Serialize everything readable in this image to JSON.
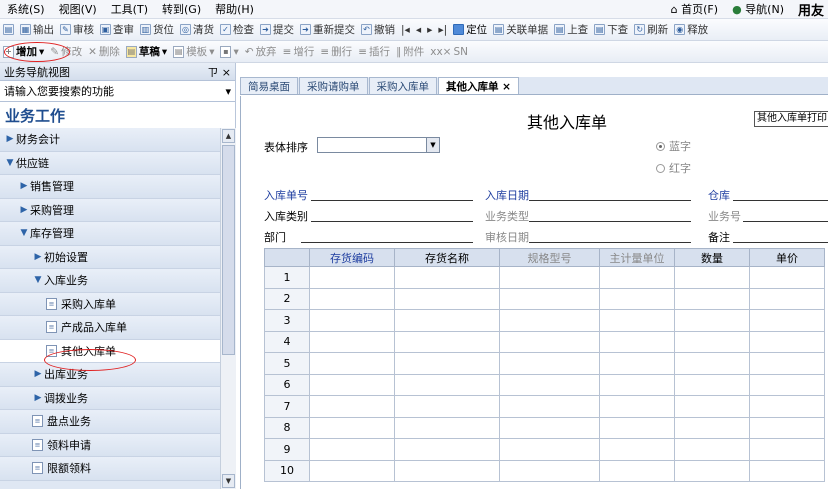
{
  "menubar": {
    "items": [
      "系统(S)",
      "视图(V)",
      "工具(T)",
      "转到(G)",
      "帮助(H)"
    ],
    "right": {
      "home": "首页(F)",
      "nav": "导航(N)",
      "brand": "用友"
    }
  },
  "toolbar1": {
    "items": [
      "输出",
      "审核",
      "查审",
      "货位",
      "清货",
      "检查",
      "提交",
      "重新提交",
      "撤销",
      "定位",
      "关联单据",
      "上查",
      "下查",
      "刷新",
      "释放"
    ]
  },
  "toolbar2": {
    "add": "增加",
    "modify": "修改",
    "delete": "删除",
    "draft": "草稿",
    "template": "模板",
    "abandon": "放弃",
    "add_row": "增行",
    "delete_row": "删行",
    "insert_row": "插行",
    "attachment": "附件",
    "sn": "SN"
  },
  "sidebar": {
    "header": "业务导航视图",
    "pin": "ㄗ ×",
    "search_placeholder": "请输入您要搜索的功能",
    "title": "业务工作",
    "items": [
      {
        "label": "财务会计",
        "arrow": "▶",
        "indent": 0
      },
      {
        "label": "供应链",
        "arrow": "▼",
        "indent": 0
      },
      {
        "label": "销售管理",
        "arrow": "▶",
        "indent": 1
      },
      {
        "label": "采购管理",
        "arrow": "▶",
        "indent": 1
      },
      {
        "label": "库存管理",
        "arrow": "▼",
        "indent": 1
      },
      {
        "label": "初始设置",
        "arrow": "▶",
        "indent": 2
      },
      {
        "label": "入库业务",
        "arrow": "▼",
        "indent": 2
      },
      {
        "label": "采购入库单",
        "arrow": "",
        "indent": 3,
        "doc": true
      },
      {
        "label": "产成品入库单",
        "arrow": "",
        "indent": 3,
        "doc": true
      },
      {
        "label": "其他入库单",
        "arrow": "",
        "indent": 3,
        "doc": true,
        "selected": true
      },
      {
        "label": "出库业务",
        "arrow": "▶",
        "indent": 2
      },
      {
        "label": "调拨业务",
        "arrow": "▶",
        "indent": 2
      },
      {
        "label": "盘点业务",
        "arrow": "",
        "indent": 2,
        "doc": true
      },
      {
        "label": "领料申请",
        "arrow": "",
        "indent": 2,
        "doc": true
      },
      {
        "label": "限额领料",
        "arrow": "",
        "indent": 2,
        "doc": true
      }
    ]
  },
  "tabs": [
    "简易桌面",
    "采购请购单",
    "采购入库单",
    "其他入库单 ×"
  ],
  "form": {
    "title": "其他入库单",
    "print_template": "其他入库单打印",
    "sort_label": "表体排序",
    "radio_blue": "蓝字",
    "radio_red": "红字",
    "fields": {
      "in_no": "入库单号",
      "in_date": "入库日期",
      "warehouse": "仓库",
      "in_type": "入库类别",
      "biz_type": "业务类型",
      "biz_no": "业务号",
      "dept": "部门",
      "audit_date": "审核日期",
      "note": "备注"
    },
    "columns": [
      "存货编码",
      "存货名称",
      "规格型号",
      "主计量单位",
      "数量",
      "单价"
    ],
    "rows": [
      "1",
      "2",
      "3",
      "4",
      "5",
      "6",
      "7",
      "8",
      "9",
      "10"
    ]
  }
}
